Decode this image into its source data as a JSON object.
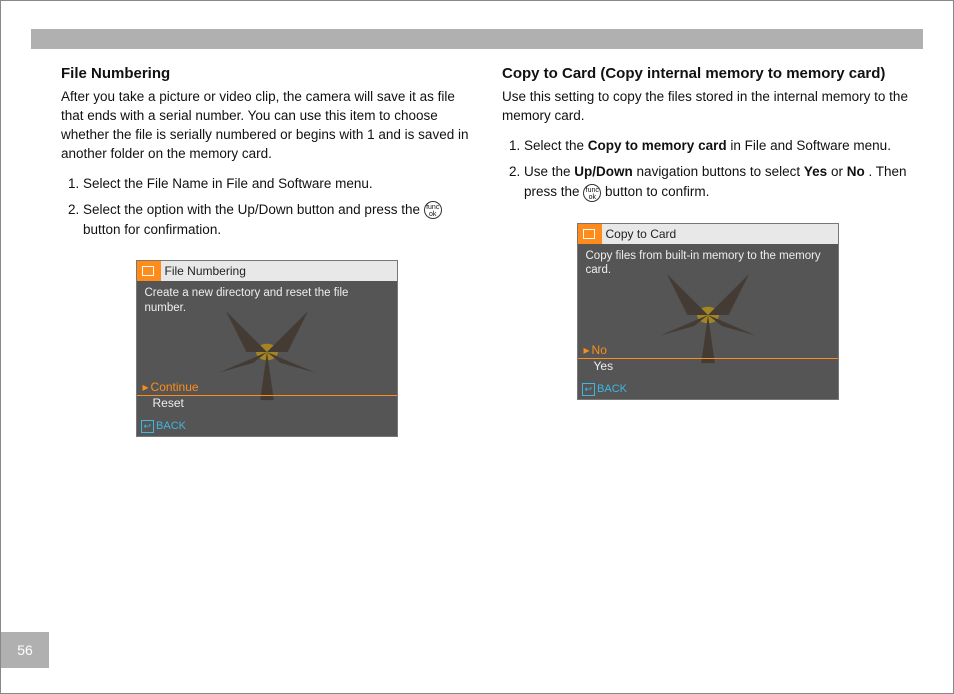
{
  "page_number": "56",
  "left": {
    "heading": "File Numbering",
    "intro": "After you take a picture or video clip, the camera will save it as file that ends with a serial number. You can use this item to choose whether the file is serially numbered or begins with 1 and is saved in another folder on the memory card.",
    "step1": "Select the File Name in File and Software menu.",
    "step2_a": "Select the option with the Up/Down button and press the ",
    "step2_b": " button for confirmation.",
    "screen": {
      "title": "File Numbering",
      "desc": "Create a new directory and reset the file number.",
      "opt_selected": "Continue",
      "opt_other": "Reset",
      "back": "BACK"
    }
  },
  "right": {
    "heading": "Copy to Card (Copy internal memory to memory card)",
    "intro": "Use this setting to copy the files stored in the internal memory to the memory card.",
    "step1_a": "Select the ",
    "step1_bold": "Copy to memory card",
    "step1_b": " in File and Software menu.",
    "step2_a": "Use the ",
    "step2_bold1": "Up/Down",
    "step2_b": " navigation buttons to select ",
    "step2_bold2": "Yes",
    "step2_c": " or ",
    "step2_bold3": "No",
    "step2_d": ". Then press the ",
    "step2_e": " button to confirm.",
    "screen": {
      "title": "Copy to Card",
      "desc": "Copy files from built-in memory to the memory card.",
      "opt_selected": "No",
      "opt_other": "Yes",
      "back": "BACK"
    }
  },
  "func_ok": "func\nok"
}
